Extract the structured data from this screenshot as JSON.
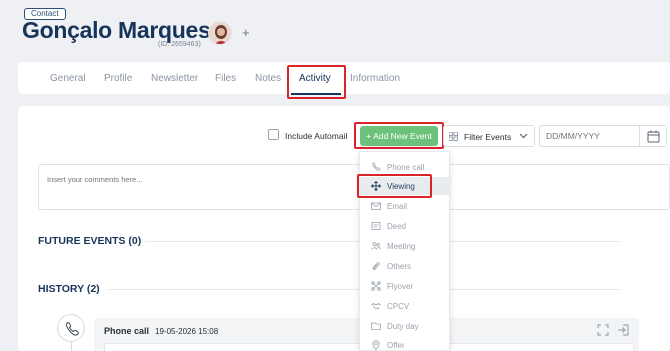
{
  "header": {
    "badge": "Contact",
    "name": "Gonçalo Marques",
    "id_text": "(ID: 2659463)",
    "add_symbol": "+"
  },
  "tabs": [
    {
      "label": "General",
      "active": false
    },
    {
      "label": "Profile",
      "active": false
    },
    {
      "label": "Newsletter",
      "active": false
    },
    {
      "label": "Files",
      "active": false
    },
    {
      "label": "Notes",
      "active": false
    },
    {
      "label": "Activity",
      "active": true
    },
    {
      "label": "Information",
      "active": false
    }
  ],
  "toolbar": {
    "include_automail": "Include Automail",
    "add_event": "+ Add New Event",
    "filter_events": "Filter Events",
    "date_placeholder": "DD/MM/YYYY"
  },
  "comments": {
    "placeholder": "Insert your comments here..."
  },
  "sections": {
    "future": "FUTURE EVENTS (0)",
    "history": "HISTORY (2)"
  },
  "history_event": {
    "type": "Phone call",
    "date": "19-05-2026 15:08"
  },
  "event_types": [
    {
      "label": "Phone call",
      "icon": "phone-icon"
    },
    {
      "label": "Viewing",
      "icon": "move-arrows-icon",
      "highlighted": true
    },
    {
      "label": "Email",
      "icon": "envelope-icon"
    },
    {
      "label": "Deed",
      "icon": "document-icon"
    },
    {
      "label": "Meeting",
      "icon": "people-icon"
    },
    {
      "label": "Others",
      "icon": "paperclip-icon"
    },
    {
      "label": "Flyover",
      "icon": "drone-icon"
    },
    {
      "label": "CPCV",
      "icon": "handshake-icon"
    },
    {
      "label": "Duty day",
      "icon": "folder-icon"
    },
    {
      "label": "Offer",
      "icon": "location-pin-icon"
    }
  ],
  "colors": {
    "primary": "#17345a",
    "accent_green": "#6cc27a",
    "highlight_red": "#d9252a"
  }
}
